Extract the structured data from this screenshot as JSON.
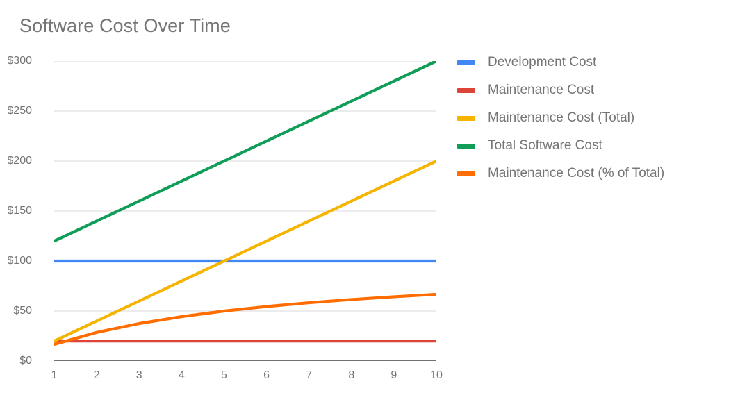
{
  "chart_data": {
    "type": "line",
    "title": "Software Cost Over Time",
    "xlabel": "",
    "ylabel": "",
    "x": [
      1,
      2,
      3,
      4,
      5,
      6,
      7,
      8,
      9,
      10
    ],
    "xtick_labels": [
      "1",
      "2",
      "3",
      "4",
      "5",
      "6",
      "7",
      "8",
      "9",
      "10"
    ],
    "ytick_labels": [
      "$0",
      "$50",
      "$100",
      "$150",
      "$200",
      "$250",
      "$300"
    ],
    "ytick_values": [
      0,
      50,
      100,
      150,
      200,
      250,
      300
    ],
    "ylim": [
      0,
      300
    ],
    "xlim": [
      1,
      10
    ],
    "grid": true,
    "legend_position": "right",
    "series": [
      {
        "name": "Development Cost",
        "color": "#4285F4",
        "values": [
          100,
          100,
          100,
          100,
          100,
          100,
          100,
          100,
          100,
          100
        ]
      },
      {
        "name": "Maintenance Cost",
        "color": "#DB4437",
        "values": [
          20,
          20,
          20,
          20,
          20,
          20,
          20,
          20,
          20,
          20
        ]
      },
      {
        "name": "Maintenance Cost (Total)",
        "color": "#F4B400",
        "values": [
          20,
          40,
          60,
          80,
          100,
          120,
          140,
          160,
          180,
          200
        ]
      },
      {
        "name": "Total Software Cost",
        "color": "#0F9D58",
        "values": [
          120,
          140,
          160,
          180,
          200,
          220,
          240,
          260,
          280,
          300
        ]
      },
      {
        "name": "Maintenance Cost (% of Total)",
        "color": "#FF6D00",
        "values": [
          16.7,
          28.6,
          37.5,
          44.4,
          50,
          54.5,
          58.3,
          61.5,
          64.3,
          66.7
        ]
      }
    ]
  },
  "legend": {
    "items": [
      {
        "label": "Development Cost",
        "color": "#4285F4"
      },
      {
        "label": "Maintenance Cost",
        "color": "#DB4437"
      },
      {
        "label": "Maintenance Cost (Total)",
        "color": "#F4B400"
      },
      {
        "label": "Total Software Cost",
        "color": "#0F9D58"
      },
      {
        "label": "Maintenance Cost (% of Total)",
        "color": "#FF6D00"
      }
    ]
  },
  "colors": {
    "axis": "#444444",
    "gridline": "#d9d9d9",
    "text": "#757575",
    "background": "#ffffff"
  }
}
